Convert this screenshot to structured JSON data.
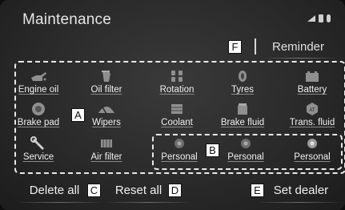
{
  "screen": {
    "title": "Maintenance",
    "reminder_label": "Reminder"
  },
  "items": [
    {
      "label": "Engine oil",
      "icon": "engine-oil-icon"
    },
    {
      "label": "Oil filter",
      "icon": "oil-filter-icon"
    },
    {
      "label": "Rotation",
      "icon": "tire-rotation-icon"
    },
    {
      "label": "Tyres",
      "icon": "tyre-icon"
    },
    {
      "label": "Battery",
      "icon": "battery-icon"
    },
    {
      "label": "Brake pad",
      "icon": "brake-pad-icon"
    },
    {
      "label": "Wipers",
      "icon": "wiper-icon"
    },
    {
      "label": "Coolant",
      "icon": "coolant-icon"
    },
    {
      "label": "Brake fluid",
      "icon": "brake-fluid-icon"
    },
    {
      "label": "Trans. fluid",
      "icon": "transmission-fluid-icon"
    },
    {
      "label": "Service",
      "icon": "wrench-icon"
    },
    {
      "label": "Air filter",
      "icon": "air-filter-icon"
    },
    {
      "label": "Personal",
      "icon": "personal-icon"
    },
    {
      "label": "Personal",
      "icon": "personal-icon"
    },
    {
      "label": "Personal",
      "icon": "personal-icon"
    }
  ],
  "bottom": {
    "delete_all": "Delete all",
    "reset_all": "Reset all",
    "set_dealer": "Set dealer"
  },
  "callouts": {
    "a": "A",
    "b": "B",
    "c": "C",
    "d": "D",
    "e": "E",
    "f": "F"
  }
}
